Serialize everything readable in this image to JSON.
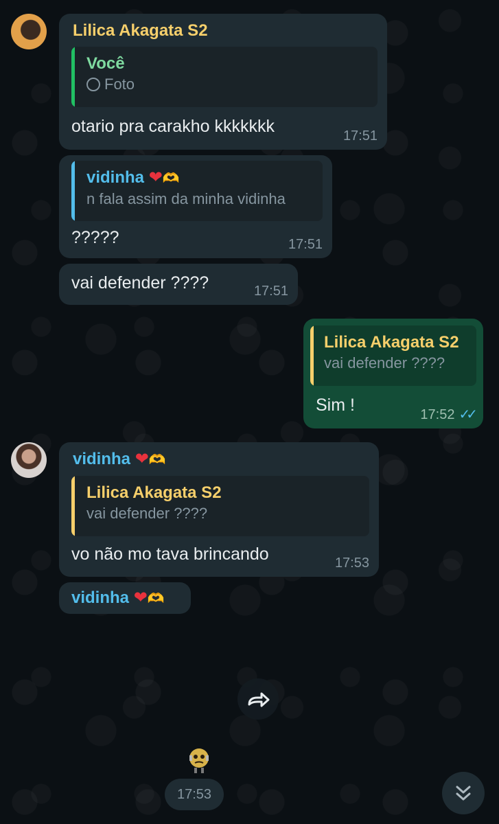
{
  "messages": [
    {
      "sender": "Lilica Akagata S2",
      "quote": {
        "name": "Você",
        "text": "Foto"
      },
      "text": "otario pra carakho kkkkkkk",
      "time": "17:51"
    },
    {
      "quote": {
        "name": "vidinha",
        "text": "n fala assim da minha vidinha"
      },
      "text": "?????",
      "time": "17:51"
    },
    {
      "text": "vai defender ????",
      "time": "17:51"
    },
    {
      "quote": {
        "name": "Lilica Akagata S2",
        "text": "vai defender ????"
      },
      "text": "Sim !",
      "time": "17:52"
    },
    {
      "sender": "vidinha",
      "quote": {
        "name": "Lilica Akagata S2",
        "text": "vai defender ????"
      },
      "text": "vo não mo tava brincando",
      "time": "17:53"
    },
    {
      "sender": "vidinha"
    }
  ],
  "sticker_time": "17:53",
  "icons": {
    "heart": "❤",
    "hands": "🫶",
    "forward": "forward-icon",
    "scroll": "double-chevron-down-icon",
    "read": "double-check-icon",
    "camera": "view-once-icon"
  },
  "colors": {
    "incoming_bubble": "#1f2c33",
    "outgoing_bubble": "#134d37",
    "background": "#0b1014",
    "sender_yellow": "#f6cf6b",
    "sender_blue": "#53bdeb",
    "read_ticks": "#53bdeb"
  }
}
